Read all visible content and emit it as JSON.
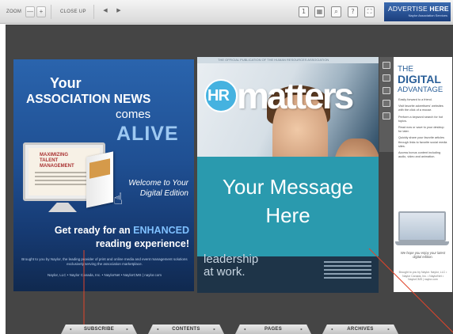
{
  "toolbar": {
    "zoom_label": "ZOOM",
    "zoom_out": "—",
    "zoom_in": "+",
    "close_up_label": "CLOSE UP",
    "prev": "◀",
    "next": "▶",
    "icons": [
      "page-icon",
      "grid-icon",
      "search-icon",
      "help-icon",
      "fullscreen-icon"
    ],
    "icon_glyphs": [
      "1",
      "▦",
      "⌕",
      "?",
      "⛶"
    ]
  },
  "advertise": {
    "big_a": "ADVERTISE ",
    "big_b": "HERE",
    "small": "Naylor Association Services"
  },
  "left_page": {
    "your": "Your",
    "assoc": "ASSOCIATION NEWS",
    "comes": "comes",
    "alive": "ALIVE",
    "welcome_1": "Welcome to Your",
    "welcome_2": "Digital Edition",
    "ready_1a": "Get ready for an ",
    "ready_1b": "ENHANCED",
    "ready_2": "reading experience!",
    "magazine_title": "MAXIMIZING TALENT MANAGEMENT",
    "fine_1": "Brought to you by Naylor, the leading provider of print and online media and event management solutions exclusively serving the association marketplace.",
    "fine_2": "Naylor, LLC • Naylor Canada, Inc. • NaylorNet • NaylorCMS | naylor.com"
  },
  "right_page": {
    "top_strip": "THE OFFICIAL PUBLICATION OF THE HUMAN RESOURCES ASSOCIATION",
    "hr": "HR",
    "matters": "matters",
    "message": "Your Message Here",
    "lead_1": "leadership",
    "lead_2": "at work."
  },
  "ad_page": {
    "the": "THE",
    "digital": "DIGITAL",
    "advantage": "ADVANTAGE",
    "items": [
      "Easily forward to a friend.",
      "Visit favorite advertisers' websites with the click of a mouse.",
      "Perform a keyword search for hot topics.",
      "Read now or save to your desktop for later.",
      "Quickly share your favorite articles through links to favorite social media sites.",
      "Access bonus content including audio, video and animation."
    ],
    "hope": "We hope you enjoy your latest digital edition.",
    "fine": "Brought to you by Naylor. Naylor, LLC • Naylor Canada, Inc. • NaylorNet • NaylorCMS | naylor.com"
  },
  "tabs": [
    "SUBSCRIBE",
    "CONTENTS",
    "PAGES",
    "ARCHIVES"
  ],
  "colors": {
    "reader_bg": "#454545",
    "callout": "#e0452b",
    "banner": "#2a9aae",
    "brand_blue": "#2a5f98"
  }
}
